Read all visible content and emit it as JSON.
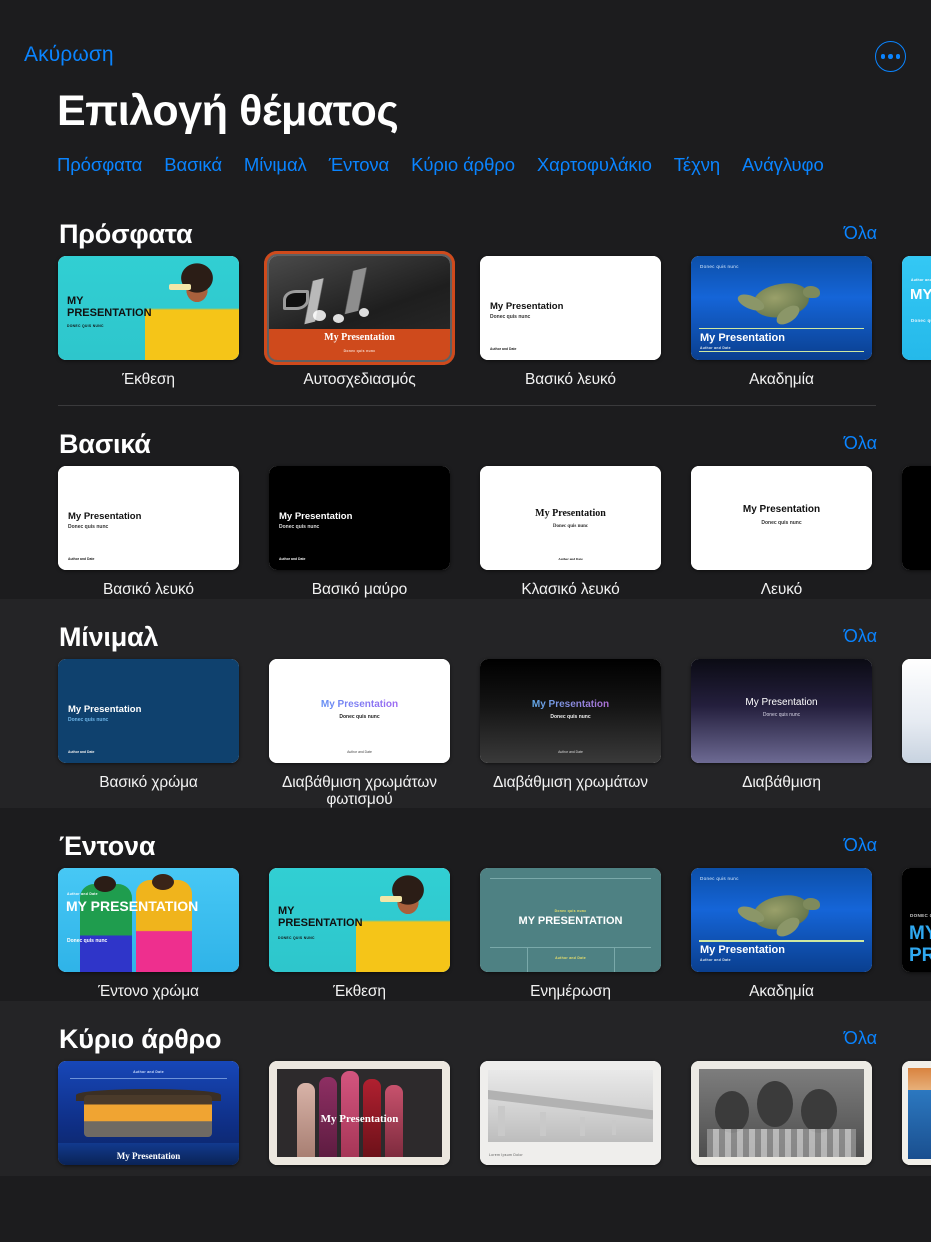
{
  "topbar": {
    "cancel_label": "Ακύρωση",
    "more_icon": "ellipsis-circle-icon",
    "accent_color": "#0a84ff"
  },
  "header": {
    "title": "Επιλογή θέματος",
    "chips": [
      {
        "label": "Πρόσφατα"
      },
      {
        "label": "Βασικά"
      },
      {
        "label": "Μίνιμαλ"
      },
      {
        "label": "Έντονα"
      },
      {
        "label": "Κύριο άρθρο"
      },
      {
        "label": "Χαρτοφυλάκιο"
      },
      {
        "label": "Τέχνη"
      },
      {
        "label": "Ανάγλυφο"
      }
    ]
  },
  "common": {
    "see_all_label": "Όλα",
    "slide_title": "My Presentation",
    "slide_subtitle": "Donec quis nunc",
    "slide_author": "Author and Date",
    "slide_title_caps": "MY PRESENTATION",
    "slide_subtitle_caps": "DONEC QUIS NUNC",
    "slide_caption": "Lorem Ipsum Dolor"
  },
  "sections": [
    {
      "id": "recent",
      "title": "Πρόσφατα",
      "see_all": "Όλα",
      "cards": [
        {
          "label": "Έκθεση",
          "art": "art-exhibit",
          "selected": false
        },
        {
          "label": "Αυτοσχεδιασμός",
          "art": "art-jazz",
          "selected": true
        },
        {
          "label": "Βασικό λευκό",
          "art": "art-white",
          "selected": false
        },
        {
          "label": "Ακαδημία",
          "art": "art-turtle",
          "selected": false
        },
        {
          "label": "",
          "art": "art-bluegrad",
          "selected": false
        }
      ]
    },
    {
      "id": "basic",
      "title": "Βασικά",
      "see_all": "Όλα",
      "cards": [
        {
          "label": "Βασικό λευκό",
          "art": "art-white",
          "selected": false
        },
        {
          "label": "Βασικό μαύρο",
          "art": "art-black",
          "selected": false
        },
        {
          "label": "Κλασικό λευκό",
          "art": "art-white",
          "selected": false
        },
        {
          "label": "Λευκό",
          "art": "art-white",
          "selected": false
        },
        {
          "label": "",
          "art": "art-black",
          "selected": false
        }
      ]
    },
    {
      "id": "minimal",
      "title": "Μίνιμαλ",
      "see_all": "Όλα",
      "cards": [
        {
          "label": "Βασικό χρώμα",
          "art": "art-navy",
          "selected": false
        },
        {
          "label": "Διαβάθμιση χρωμάτων φωτισμού",
          "art": "art-white",
          "selected": false
        },
        {
          "label": "Διαβάθμιση χρωμάτων",
          "art": "art-darkgrad",
          "selected": false
        },
        {
          "label": "Διαβάθμιση",
          "art": "art-purplegrad",
          "selected": false
        },
        {
          "label": "",
          "art": "art-lightgrad",
          "selected": false
        }
      ]
    },
    {
      "id": "vivid",
      "title": "Έντονα",
      "see_all": "Όλα",
      "cards": [
        {
          "label": "Έντονο χρώμα",
          "art": "art-vivid",
          "selected": false
        },
        {
          "label": "Έκθεση",
          "art": "art-exhibit",
          "selected": false
        },
        {
          "label": "Ενημέρωση",
          "art": "art-teal",
          "selected": false
        },
        {
          "label": "Ακαδημία",
          "art": "art-turtle",
          "selected": false
        },
        {
          "label": "",
          "art": "art-black",
          "selected": false
        }
      ]
    },
    {
      "id": "editorial",
      "title": "Κύριο άρθρο",
      "see_all": "Όλα",
      "cards": [
        {
          "label": "",
          "art": "art-opera",
          "selected": false
        },
        {
          "label": "",
          "art": "art-lips",
          "selected": false
        },
        {
          "label": "",
          "art": "art-bridge",
          "selected": false
        },
        {
          "label": "",
          "art": "art-kids",
          "selected": false
        },
        {
          "label": "",
          "art": "art-seaside",
          "selected": false
        }
      ]
    }
  ]
}
